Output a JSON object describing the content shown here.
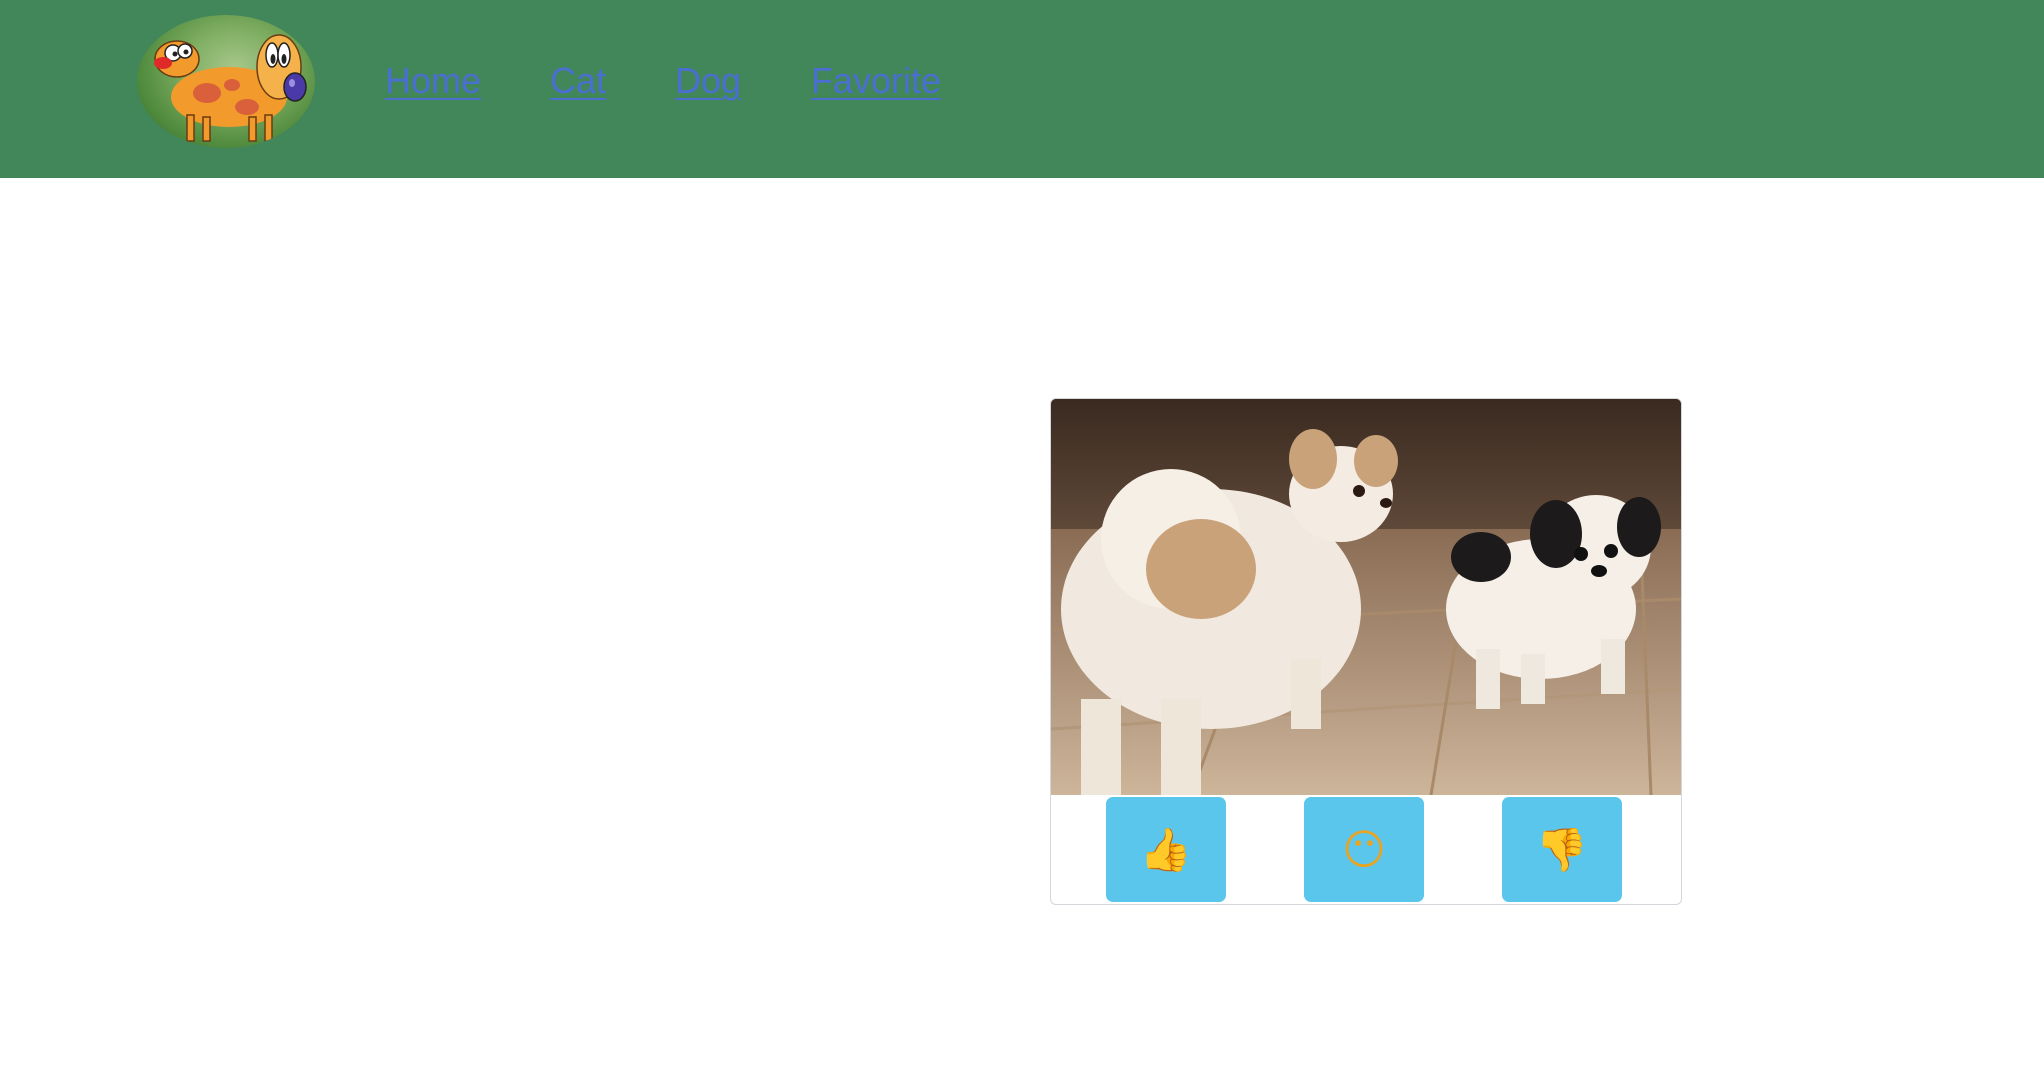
{
  "header": {
    "background": "#42875a",
    "logo_icon": "catdog-cartoon-logo"
  },
  "nav": {
    "home": "Home",
    "cat": "Cat",
    "dog": "Dog",
    "favorite": "Favorite",
    "link_color": "#4a6fd0"
  },
  "card": {
    "image_subject": "two japanese chin dogs on tiled floor",
    "buttons": {
      "like": {
        "icon": "thumbs-up-icon",
        "glyph": "👍"
      },
      "neutral": {
        "icon": "neutral-face-icon",
        "glyph": "😶"
      },
      "dislike": {
        "icon": "thumbs-down-icon",
        "glyph": "👎"
      },
      "color": "#5bc6ec"
    }
  }
}
